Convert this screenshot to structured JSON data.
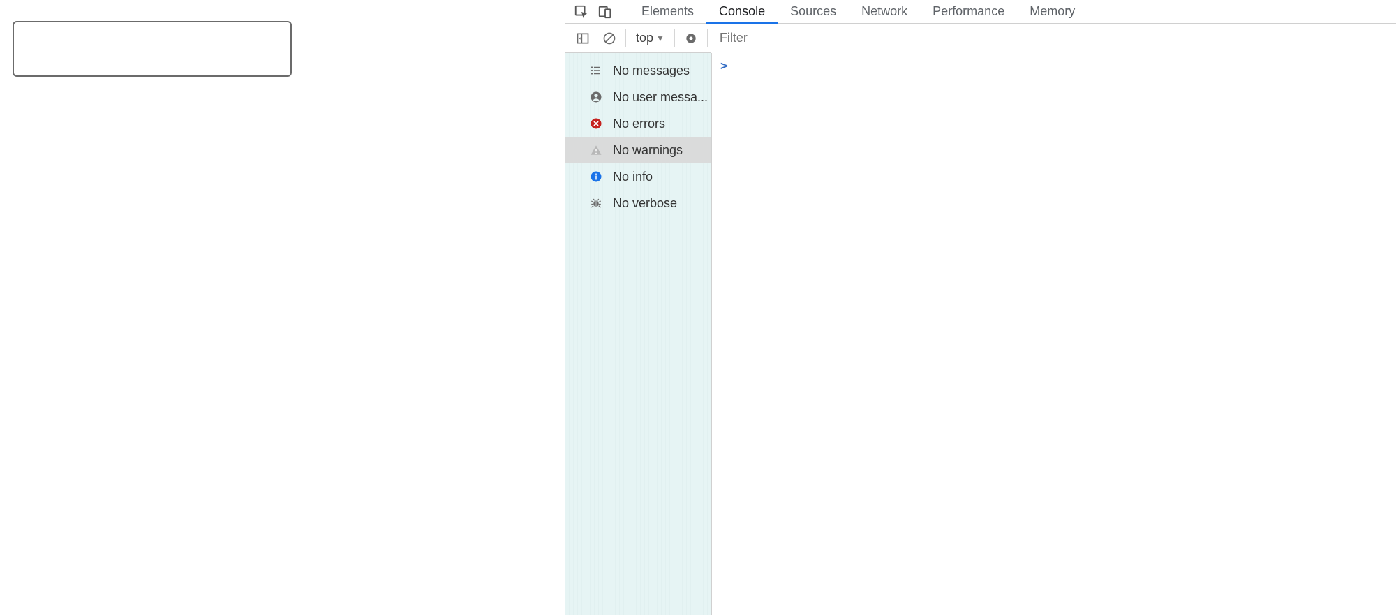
{
  "page": {
    "input_value": ""
  },
  "tabs": {
    "items": [
      "Elements",
      "Console",
      "Sources",
      "Network",
      "Performance",
      "Memory"
    ],
    "active_index": 1
  },
  "toolbar": {
    "scope_label": "top",
    "filter_placeholder": "Filter"
  },
  "sidebar": {
    "items": [
      {
        "label": "No messages",
        "icon": "list-icon",
        "color": "#6b6b6b",
        "bg": "transparent"
      },
      {
        "label": "No user messa...",
        "icon": "user-icon",
        "color": "#6b6b6b",
        "bg": "transparent"
      },
      {
        "label": "No errors",
        "icon": "error-icon",
        "color": "#fff",
        "bg": "#c5221f"
      },
      {
        "label": "No warnings",
        "icon": "warning-icon",
        "color": "#b7b7b7",
        "bg": "transparent",
        "selected": true
      },
      {
        "label": "No info",
        "icon": "info-icon",
        "color": "#fff",
        "bg": "#1a73e8"
      },
      {
        "label": "No verbose",
        "icon": "debug-icon",
        "color": "#6b6b6b",
        "bg": "transparent"
      }
    ]
  },
  "console": {
    "prompt": ">"
  }
}
